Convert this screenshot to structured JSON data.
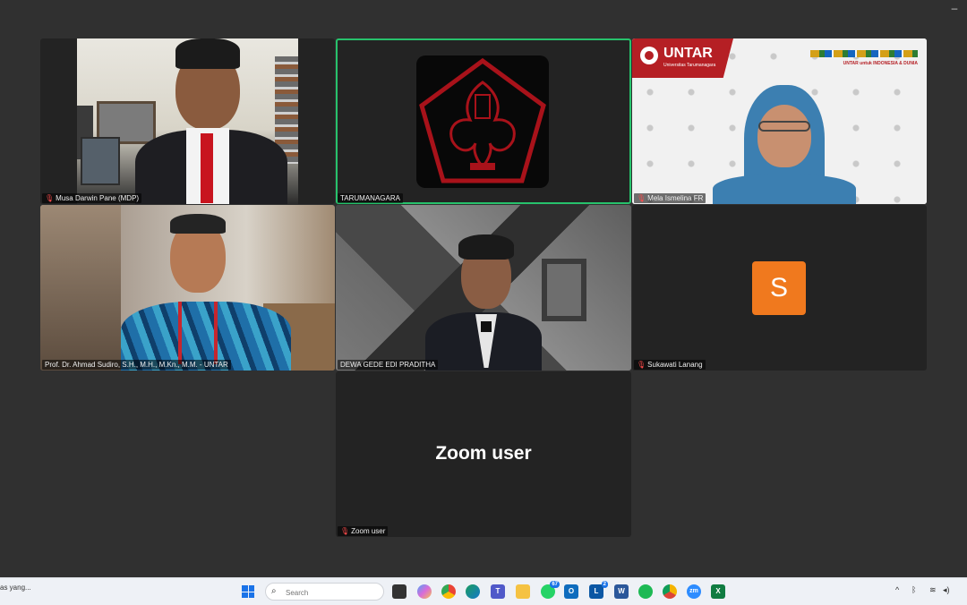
{
  "window": {
    "minimize_glyph": "–"
  },
  "participants": [
    {
      "name": "Musa Darwin Pane (MDP)",
      "muted": true
    },
    {
      "name": "TARUMANAGARA",
      "muted": false
    },
    {
      "name": "Mela Ismelina FR",
      "muted": true
    },
    {
      "name": "Prof. Dr. Ahmad Sudiro, S.H., M.H., M.Kn., M.M. - UNTAR",
      "muted": false
    },
    {
      "name": "DEWA GEDE EDI PRADITHA",
      "muted": false
    },
    {
      "name": "Sukawati Lanang",
      "muted": true
    },
    {
      "name": "Zoom user",
      "muted": true
    }
  ],
  "tiles": {
    "untar_brand": "UNTAR",
    "untar_sub": "Universitas Tarumanagara",
    "untar_tagline": "UNTAR untuk INDONESIA & DUNIA",
    "avatar_letter": "S",
    "avatar_color": "#f0791e",
    "zoom_user_center": "Zoom user"
  },
  "taskbar": {
    "left_text": "as yang...",
    "search_placeholder": "Search",
    "whatsapp_badge": "67",
    "lync_badge": "2",
    "zoom_label": "zm"
  },
  "colors": {
    "active_speaker": "#27c26c",
    "untar_red": "#b51f24"
  }
}
